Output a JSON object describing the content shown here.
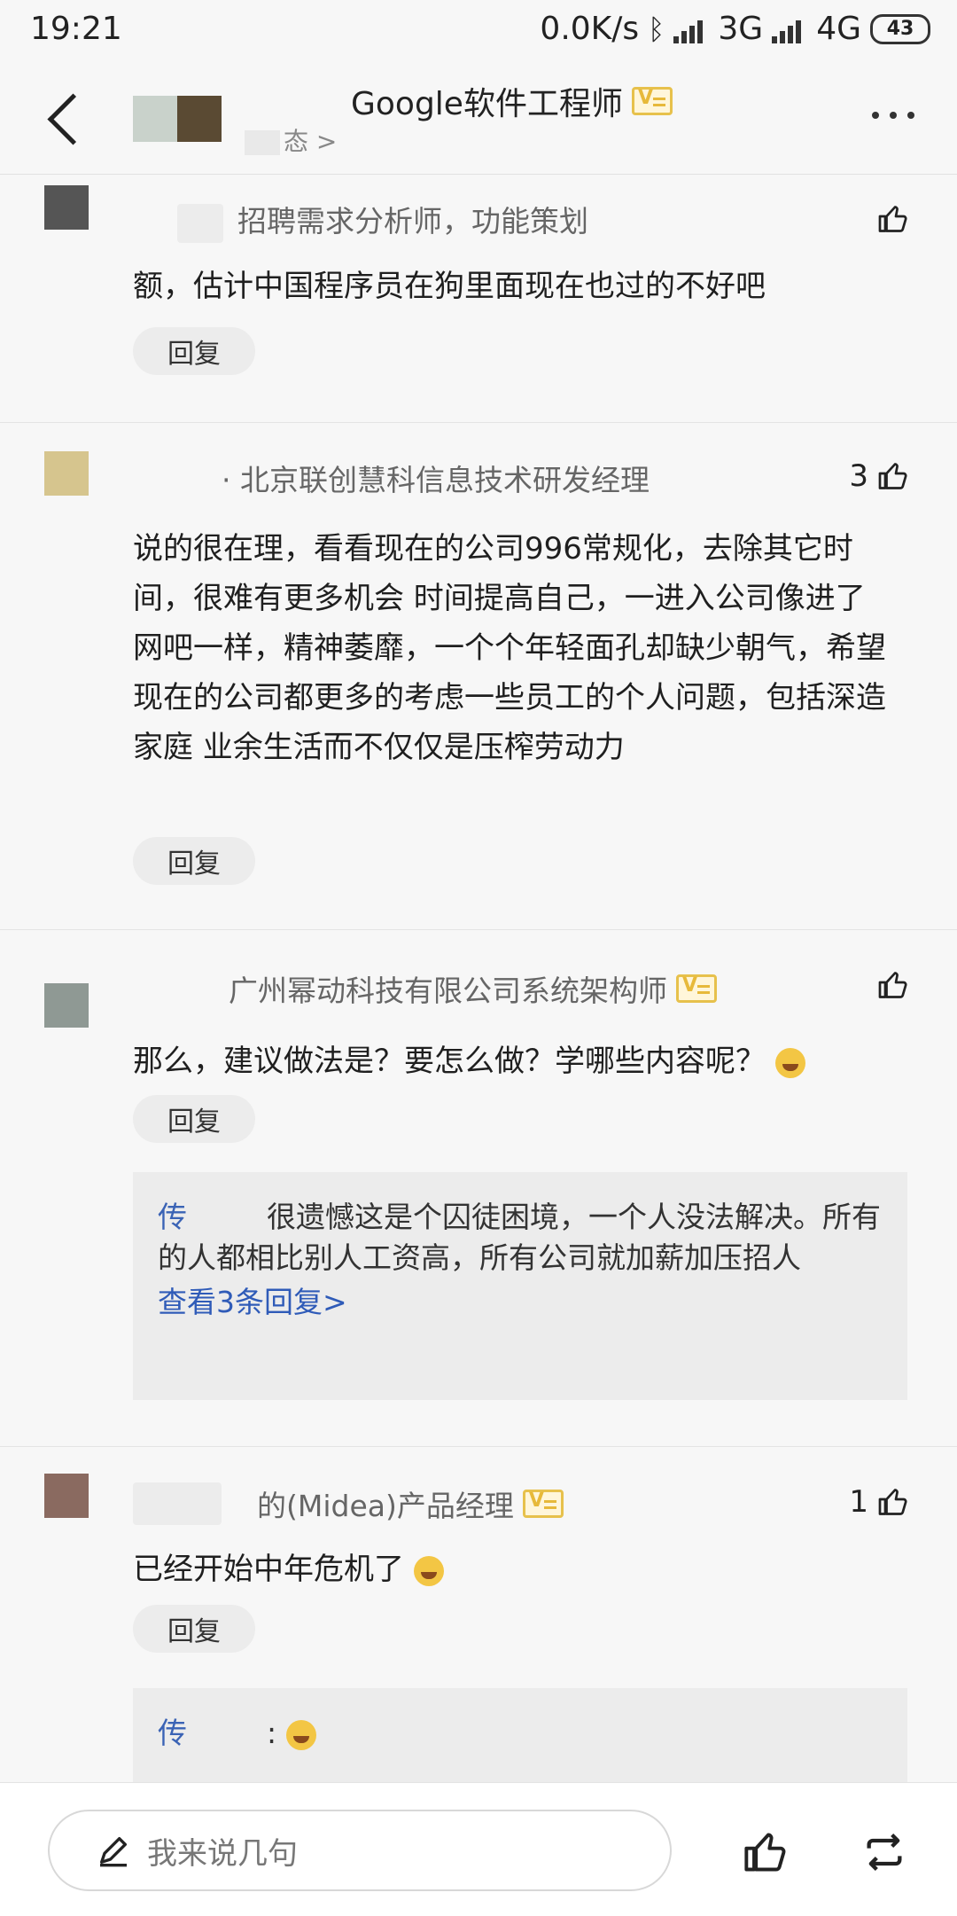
{
  "status_bar": {
    "time": "19:21",
    "net_speed": "0.0K/s",
    "network_3g": "3G",
    "network_4g": "4G",
    "battery": "43"
  },
  "header": {
    "title": "Google软件工程师",
    "subtitle": "态 >"
  },
  "comments": [
    {
      "author_meta": "招聘需求分析师，功能策划",
      "likes": "",
      "text": "额，估计中国程序员在狗里面现在也过的不好吧",
      "reply_label": "回复"
    },
    {
      "author_meta": "· 北京联创慧科信息技术研发经理",
      "likes": "3",
      "text": "说的很在理，看看现在的公司996常规化，去除其它时间，很难有更多机会  时间提高自己，一进入公司像进了网吧一样，精神萎靡，一个个年轻面孔却缺少朝气，希望现在的公司都更多的考虑一些员工的个人问题，包括深造 家庭 业余生活而不仅仅是压榨劳动力",
      "reply_label": "回复"
    },
    {
      "author_meta": "广州幂动科技有限公司系统架构师",
      "likes": "",
      "text": "那么，建议做法是？要怎么做？学哪些内容呢？",
      "reply_label": "回复",
      "sub_reply": {
        "user": "传",
        "text": "很遗憾这是个囚徒困境，一个人没法解决。所有的人都相比别人工资高，所有公司就加薪加压招人",
        "more_link": "查看3条回复>"
      }
    },
    {
      "author_meta": "的(Midea)产品经理",
      "likes": "1",
      "text": "已经开始中年危机了",
      "reply_label": "回复",
      "sub_reply": {
        "user": "传",
        "text": ":"
      }
    }
  ],
  "bottom_bar": {
    "input_placeholder": "我来说几句"
  },
  "colors": {
    "link": "#2f5bb8",
    "badge": "#e7c14c",
    "background": "#f7f7f7"
  }
}
